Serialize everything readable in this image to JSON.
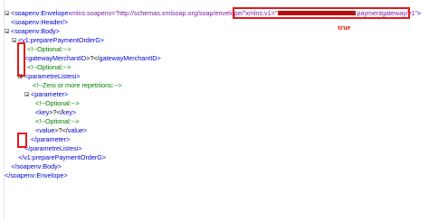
{
  "lines": [
    {
      "start": "<",
      "tag": "soapenv:Envelope",
      "mid1": " ",
      "attr1": "xmlns:soapenv=",
      "val1": "\"http://schemas.xmlsoap.org/soap/envelope/\"",
      "mid2": " ",
      "attr2": "xmlns:v1=",
      "val2a": "\"",
      "val2b": "paymentgateway/v1\"",
      "end": ">"
    },
    {
      "text": "<soapenv:Header/>"
    },
    {
      "text": "<soapenv:Body>"
    },
    {
      "text": "<v1:preparePaymentOrderG>"
    },
    {
      "text": "<!--Optional:-->"
    },
    {
      "pre": "<",
      "tag": "gatewayMerchantID",
      "mid": ">?</",
      "tag2": "gatewayMerchantID",
      "end": ">"
    },
    {
      "text": "<!--Optional:-->"
    },
    {
      "text": "<parametreListesi>"
    },
    {
      "text": "<!--Zero or more repetitions:-->"
    },
    {
      "text": "<parameter>"
    },
    {
      "text": "<!--Optional:-->"
    },
    {
      "pre": "<",
      "tag": "key",
      "mid": ">?</",
      "tag2": "key",
      "end": ">"
    },
    {
      "text": "<!--Optional:-->"
    },
    {
      "pre": "<",
      "tag": "value",
      "mid": ">?</",
      "tag2": "value",
      "end": ">"
    },
    {
      "text": "</parameter>"
    },
    {
      "text": "</parametreListesi>"
    },
    {
      "text": "</v1:preparePaymentOrderG>"
    },
    {
      "text": "</soapenv:Body>"
    },
    {
      "text": "</soapenv:Envelope>"
    }
  ],
  "annotation": {
    "text": "true"
  },
  "colors": {
    "tag": "#0000cc",
    "attr": "#7a1fa2",
    "comment": "#008000",
    "annotation": "#e11b1b"
  }
}
